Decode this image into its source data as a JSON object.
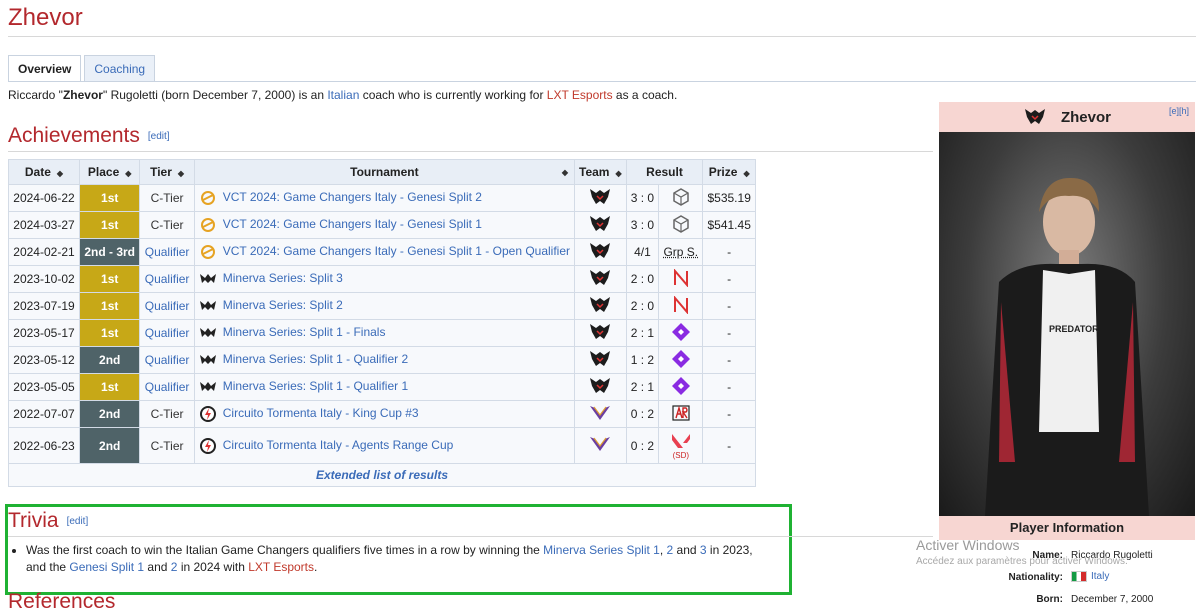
{
  "page": {
    "title": "Zhevor",
    "tabs": [
      {
        "label": "Overview"
      },
      {
        "label": "Coaching"
      }
    ],
    "intro": {
      "before_nick": "Riccardo \"",
      "nick": "Zhevor",
      "after_nick": "\" Rugoletti (born December 7, 2000) is an ",
      "nationality_link": "Italian",
      "middle": " coach who is currently working for ",
      "team_link": "LXT Esports",
      "end": " as a coach."
    }
  },
  "achievements": {
    "heading": "Achievements",
    "edit": "[edit]",
    "columns": [
      "Date",
      "Place",
      "Tier",
      "Tournament",
      "Team",
      "Result",
      "Prize"
    ],
    "rows": [
      {
        "date": "2024-06-22",
        "place": "1st",
        "tier": "C-Tier",
        "tournament": "VCT 2024: Game Changers Italy - Genesi Split 2",
        "score": "3 : 0",
        "prize": "$535.19"
      },
      {
        "date": "2024-03-27",
        "place": "1st",
        "tier": "C-Tier",
        "tournament": "VCT 2024: Game Changers Italy - Genesi Split 1",
        "score": "3 : 0",
        "prize": "$541.45"
      },
      {
        "date": "2024-02-21",
        "place": "2nd - 3rd",
        "tier": "Qualifier",
        "tournament": "VCT 2024: Game Changers Italy - Genesi Split 1 - Open Qualifier",
        "score": "4/1",
        "opp_text": "Grp S.",
        "prize": "-"
      },
      {
        "date": "2023-10-02",
        "place": "1st",
        "tier": "Qualifier",
        "tournament": "Minerva Series: Split 3",
        "score": "2 : 0",
        "prize": "-"
      },
      {
        "date": "2023-07-19",
        "place": "1st",
        "tier": "Qualifier",
        "tournament": "Minerva Series: Split 2",
        "score": "2 : 0",
        "prize": "-"
      },
      {
        "date": "2023-05-17",
        "place": "1st",
        "tier": "Qualifier",
        "tournament": "Minerva Series: Split 1 - Finals",
        "score": "2 : 1",
        "prize": "-"
      },
      {
        "date": "2023-05-12",
        "place": "2nd",
        "tier": "Qualifier",
        "tournament": "Minerva Series: Split 1 - Qualifier 2",
        "score": "1 : 2",
        "prize": "-"
      },
      {
        "date": "2023-05-05",
        "place": "1st",
        "tier": "Qualifier",
        "tournament": "Minerva Series: Split 1 - Qualifier 1",
        "score": "2 : 1",
        "prize": "-"
      },
      {
        "date": "2022-07-07",
        "place": "2nd",
        "tier": "C-Tier",
        "tournament": "Circuito Tormenta Italy - King Cup #3",
        "score": "0 : 2",
        "prize": "-"
      },
      {
        "date": "2022-06-23",
        "place": "2nd",
        "tier": "C-Tier",
        "tournament": "Circuito Tormenta Italy - Agents Range Cup",
        "score": "0 : 2",
        "opp_text": "(SD)",
        "prize": "-"
      }
    ],
    "extended_link": "Extended list of results"
  },
  "trivia": {
    "heading": "Trivia",
    "edit": "[edit]",
    "p1": "Was the first coach to win the Italian Game Changers qualifiers five times in a row by winning the ",
    "l1": "Minerva Series Split 1",
    "p2": ", ",
    "l2": "2",
    "p3": " and ",
    "l3": "3",
    "p4": " in 2023,",
    "p5": "and the ",
    "l4": "Genesi Split 1",
    "p6": " and ",
    "l5": "2",
    "p7": " in 2024 with ",
    "l6": "LXT Esports",
    "p8": "."
  },
  "references": {
    "heading": "References"
  },
  "infobox": {
    "name": "Zhevor",
    "edit": "[e][h]",
    "section": "Player Information",
    "fields": [
      {
        "label": "Name:",
        "value": "Riccardo Rugoletti"
      },
      {
        "label": "Nationality:",
        "value": "Italy"
      },
      {
        "label": "Born:",
        "value": "December 7, 2000"
      }
    ]
  },
  "watermark": {
    "title": "Activer Windows",
    "subtitle": "Accédez aux paramètres pour activer Windows."
  },
  "colors": {
    "heading_red": "#b3282d",
    "link_blue": "#3a6bb8",
    "place_gold": "#c7a817",
    "place_grey": "#4f6368",
    "highlight_green": "#1fb233",
    "infobox_pink": "#f7d6d2"
  }
}
